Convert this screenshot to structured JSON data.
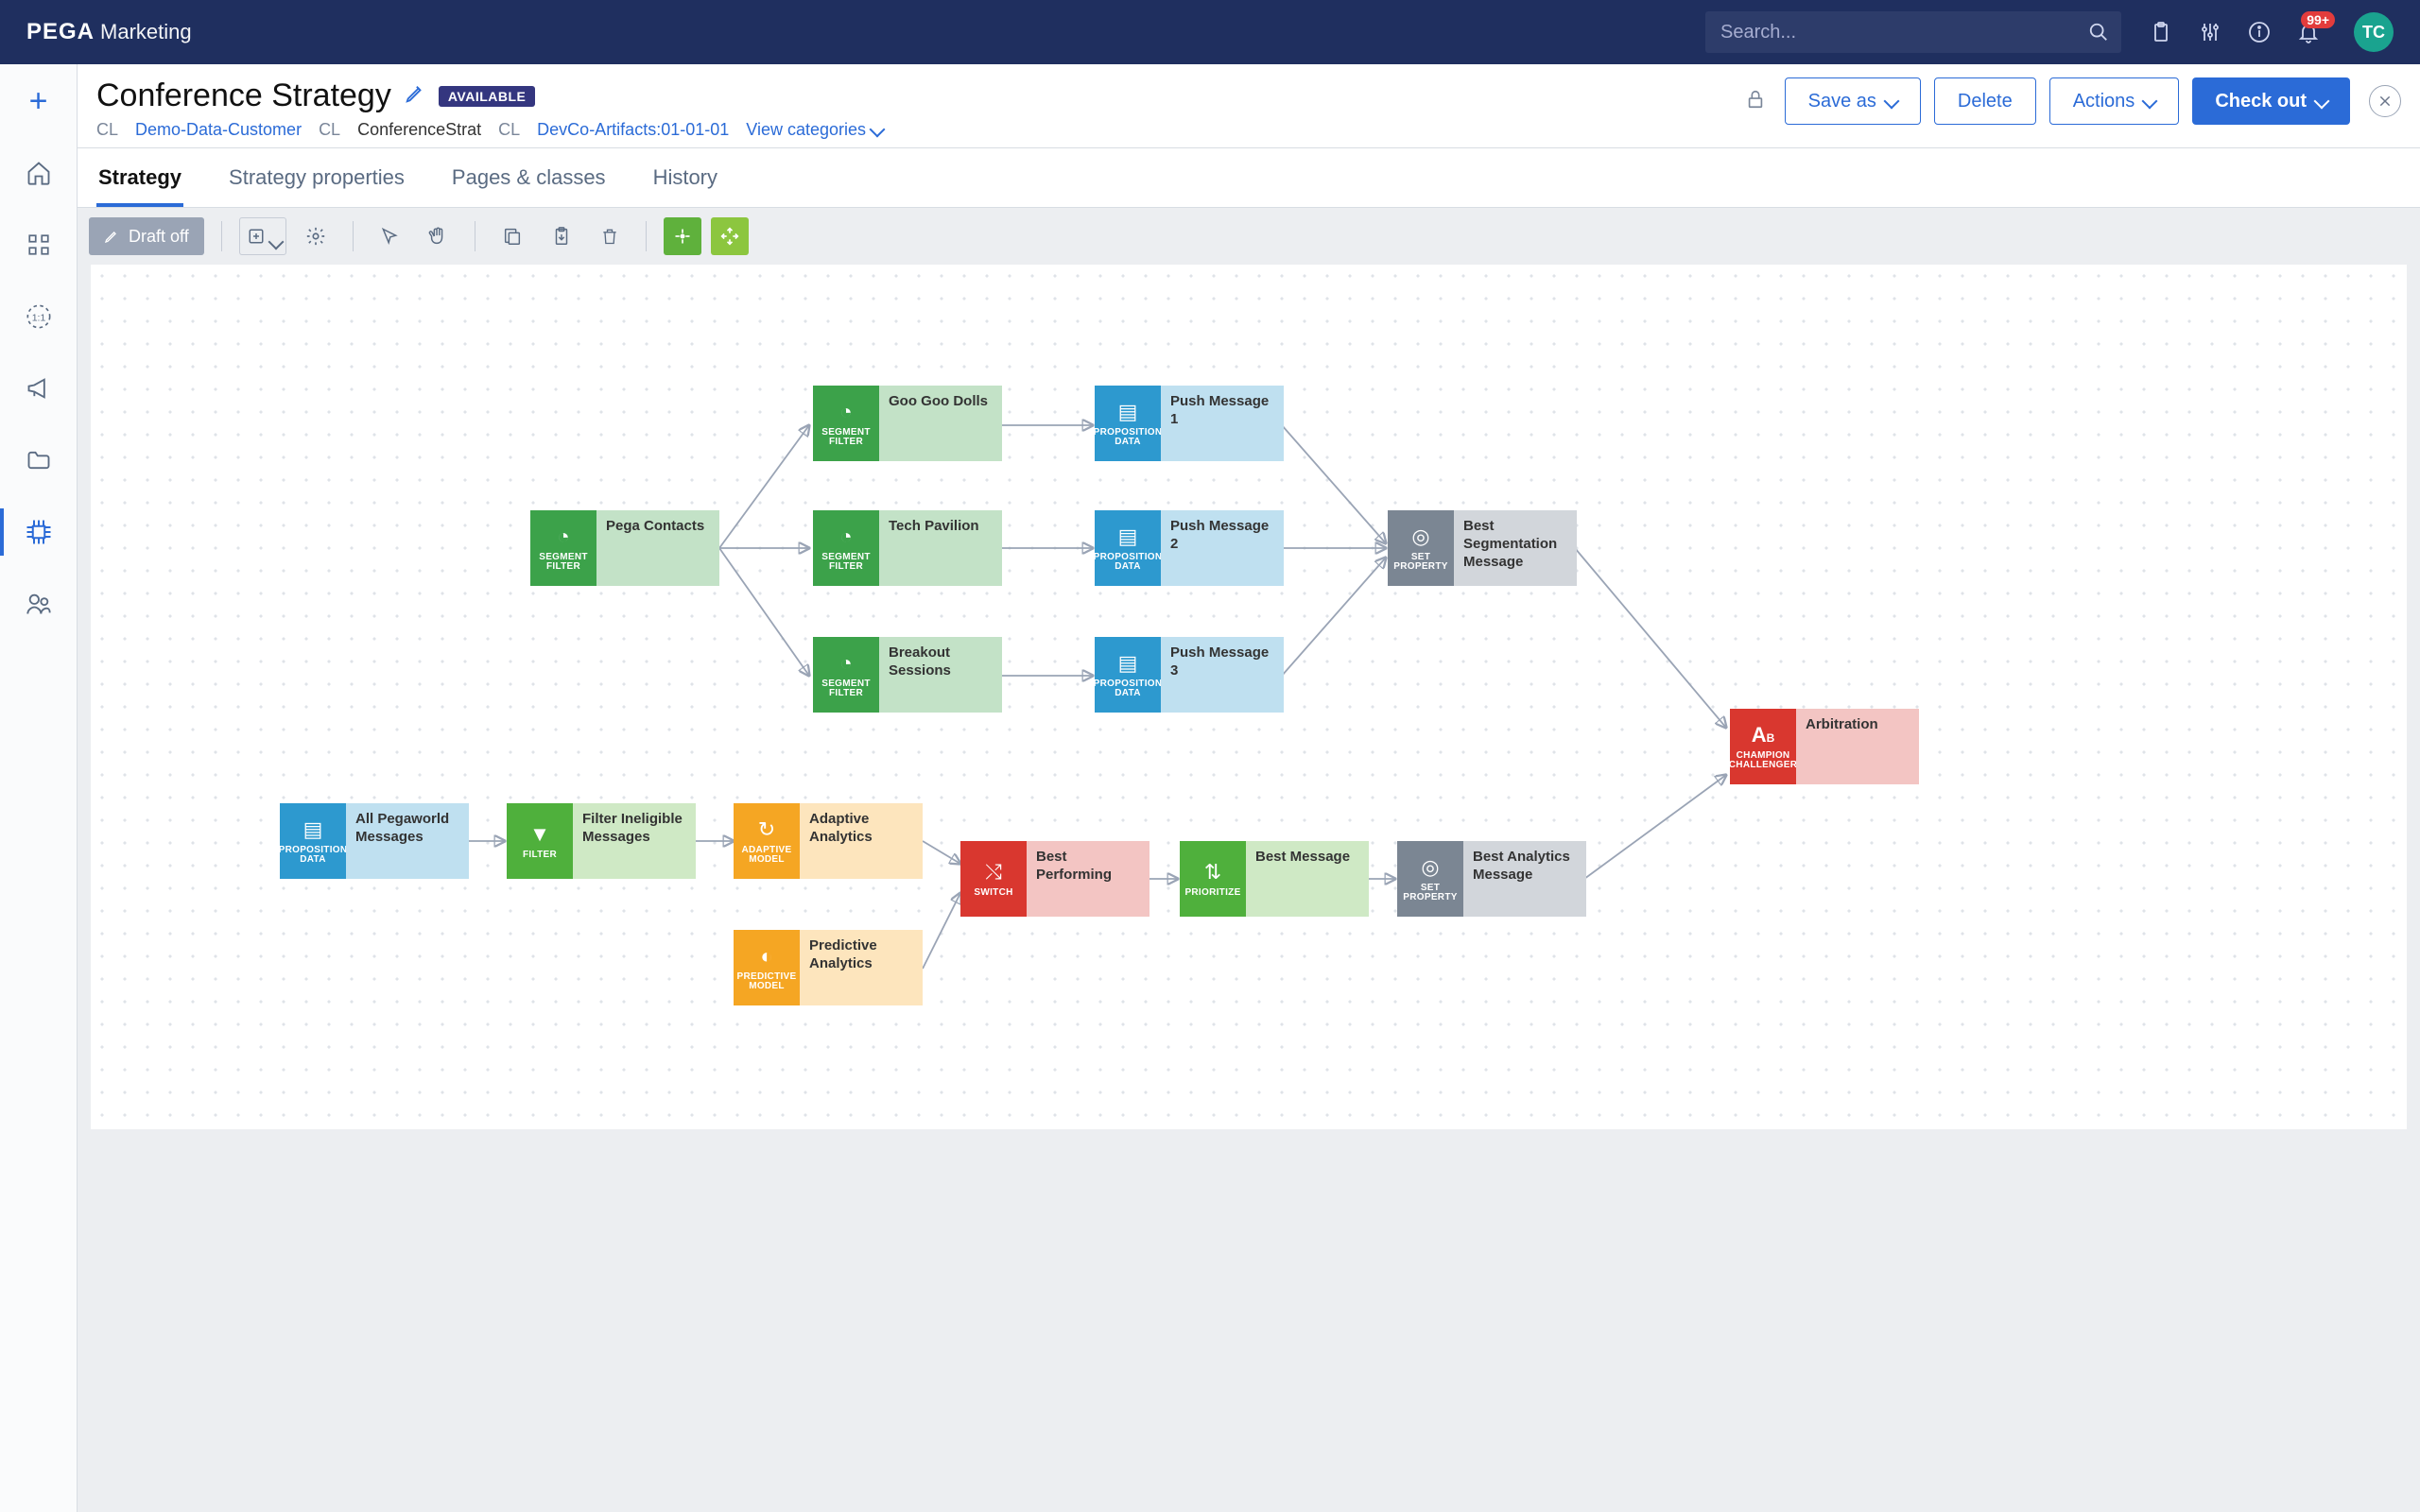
{
  "brand": {
    "name": "PEGA",
    "product": "Marketing"
  },
  "search": {
    "placeholder": "Search..."
  },
  "notification_badge": "99+",
  "avatar_initials": "TC",
  "rail_items": [
    "plus",
    "home",
    "apps",
    "one-to-one",
    "campaign",
    "folder",
    "strategy",
    "users"
  ],
  "header": {
    "title": "Conference Strategy",
    "status_badge": "AVAILABLE",
    "cl_label": "CL",
    "path_customer": "Demo-Data-Customer",
    "path_class": "ConferenceStrat",
    "path_ruleset": "DevCo-Artifacts:01-01-01",
    "view_categories": "View categories"
  },
  "buttons": {
    "save_as": "Save as",
    "delete": "Delete",
    "actions": "Actions",
    "checkout": "Check out"
  },
  "tabs": {
    "strategy": "Strategy",
    "properties": "Strategy properties",
    "pages": "Pages & classes",
    "history": "History"
  },
  "toolbar": {
    "draft": "Draft off"
  },
  "shape_labels": {
    "segment_filter": "SEGMENT FILTER",
    "proposition_data": "PROPOSITION DATA",
    "filter": "FILTER",
    "adaptive_model": "ADAPTIVE MODEL",
    "predictive_model": "PREDICTIVE MODEL",
    "switch": "SWITCH",
    "prioritize": "PRIORITIZE",
    "set_property": "SET PROPERTY",
    "champion_challenger": "CHAMPION CHALLENGER"
  },
  "nodes": {
    "pega_contacts": "Pega Contacts",
    "goo": "Goo Goo Dolls",
    "tech": "Tech Pavilion",
    "breakout": "Breakout Sessions",
    "push1": "Push Message 1",
    "push2": "Push Message 2",
    "push3": "Push Message 3",
    "best_seg": "Best Segmentation Message",
    "all_msgs": "All Pegaworld Messages",
    "filter_inel": "Filter Ineligible Messages",
    "adaptive": "Adaptive Analytics",
    "predictive": "Predictive Analytics",
    "best_perf": "Best Performing",
    "best_msg": "Best Message",
    "best_analytics": "Best Analytics Message",
    "arbitration": "Arbitration"
  }
}
